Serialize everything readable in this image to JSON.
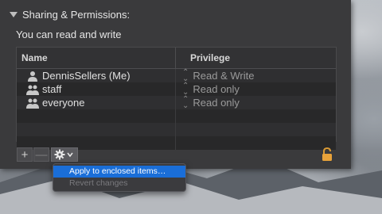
{
  "section": {
    "title": "Sharing & Permissions:",
    "access_summary": "You can read and write"
  },
  "table": {
    "columns": [
      "Name",
      "Privilege"
    ],
    "rows": [
      {
        "name": "DennisSellers (Me)",
        "privilege": "Read & Write",
        "icon": "user-icon"
      },
      {
        "name": "staff",
        "privilege": "Read only",
        "icon": "group-icon"
      },
      {
        "name": "everyone",
        "privilege": "Read only",
        "icon": "group-icon"
      }
    ]
  },
  "toolbar": {
    "add_label": "+",
    "remove_label": "—",
    "action_icon": "gear-icon"
  },
  "menu": {
    "items": [
      {
        "label": "Apply to enclosed items…",
        "state": "highlighted"
      },
      {
        "label": "Revert changes",
        "state": "disabled"
      }
    ]
  },
  "colors": {
    "highlight": "#1a6ed8",
    "panel": "#3a3a3c",
    "lock": "#e8a23a"
  }
}
